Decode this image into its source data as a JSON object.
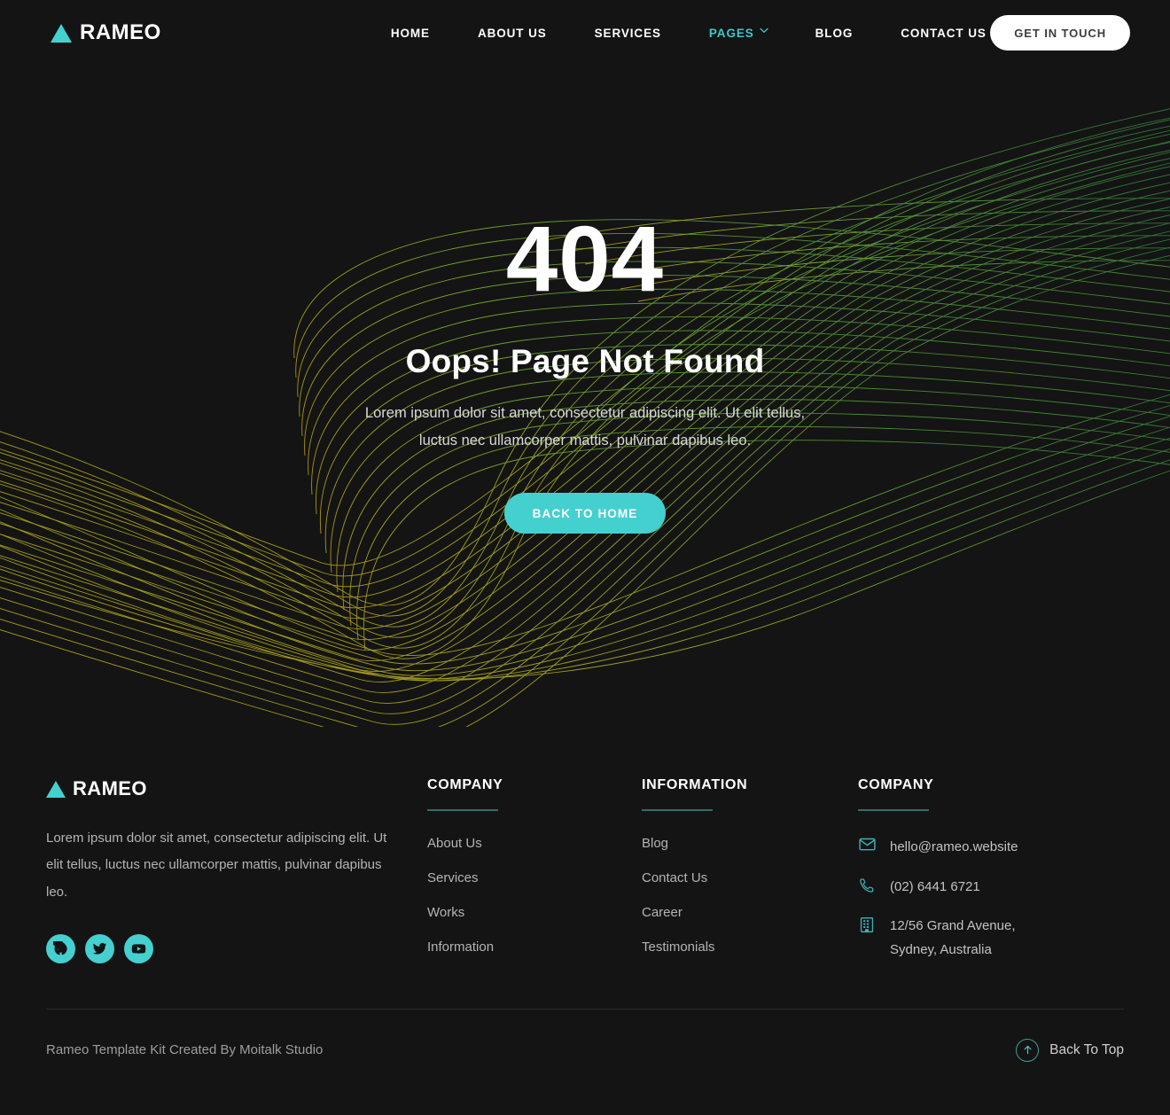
{
  "theme": {
    "background": "#141414",
    "accent": "#45d0d0",
    "accent_dark": "#3bc8c8",
    "rule": "#2f6e6e",
    "text_muted": "#b4b4b4"
  },
  "header": {
    "logo_text": "RAMEO",
    "nav": [
      {
        "label": "HOME",
        "active": false,
        "has_chevron": false
      },
      {
        "label": "ABOUT US",
        "active": false,
        "has_chevron": false
      },
      {
        "label": "SERVICES",
        "active": false,
        "has_chevron": false
      },
      {
        "label": "PAGES",
        "active": true,
        "has_chevron": true
      },
      {
        "label": "BLOG",
        "active": false,
        "has_chevron": false
      },
      {
        "label": "CONTACT US",
        "active": false,
        "has_chevron": false
      }
    ],
    "cta_label": "GET IN TOUCH"
  },
  "hero": {
    "error_code": "404",
    "title": "Oops! Page Not Found",
    "description_line1": "Lorem ipsum dolor sit amet, consectetur adipiscing elit. Ut elit tellus,",
    "description_line2": "luctus nec ullamcorper mattis, pulvinar dapibus leo.",
    "button_label": "BACK TO HOME"
  },
  "footer": {
    "logo_text": "RAMEO",
    "about": "Lorem ipsum dolor sit amet, consectetur adipiscing elit. Ut elit tellus, luctus nec ullamcorper mattis, pulvinar dapibus leo.",
    "socials": [
      {
        "name": "facebook-icon"
      },
      {
        "name": "twitter-icon"
      },
      {
        "name": "youtube-icon"
      }
    ],
    "columns": [
      {
        "heading": "COMPANY",
        "links": [
          "About Us",
          "Services",
          "Works",
          "Information"
        ]
      },
      {
        "heading": "INFORMATION",
        "links": [
          "Blog",
          "Contact Us",
          "Career",
          "Testimonials"
        ]
      }
    ],
    "contact": {
      "heading": "COMPANY",
      "email": "hello@rameo.website",
      "phone": "(02) 6441 6721",
      "address_line1": "12/56 Grand Avenue,",
      "address_line2": "Sydney, Australia"
    },
    "copyright": "Rameo Template Kit Created By Moitalk Studio",
    "back_to_top": "Back To Top"
  }
}
